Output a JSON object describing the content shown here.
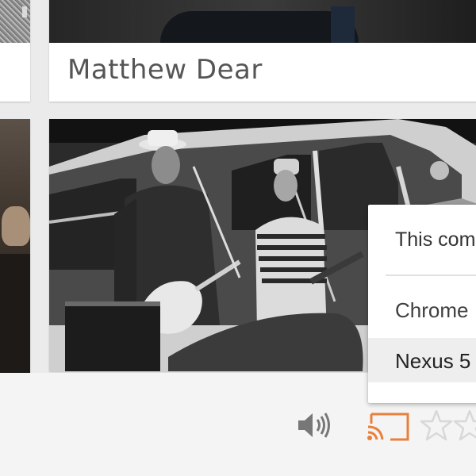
{
  "cards": {
    "top": {
      "title": "Matthew Dear"
    }
  },
  "cast_menu": {
    "header": "This com",
    "devices": [
      {
        "label": "Chrome",
        "selected": false
      },
      {
        "label": "Nexus 5",
        "selected": true
      }
    ]
  },
  "player": {
    "icons": [
      "volume-icon",
      "cast-icon",
      "star-icon",
      "star-icon"
    ],
    "cast_color": "#e7813b",
    "star_color": "#d8d8d8",
    "rating": 0
  }
}
